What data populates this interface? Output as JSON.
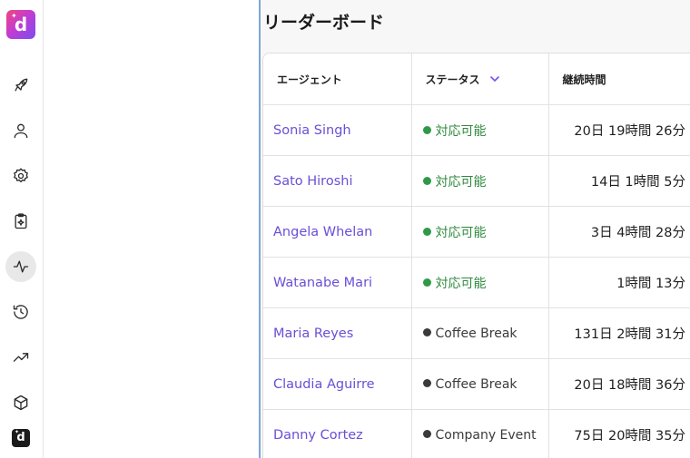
{
  "page": {
    "title": "リーダーボード"
  },
  "brand": {
    "logo_letter": "d"
  },
  "nav": [
    {
      "icon": "rocket-icon",
      "active": false
    },
    {
      "icon": "user-icon",
      "active": false
    },
    {
      "icon": "gear-icon",
      "active": false
    },
    {
      "icon": "clipboard-sparkle-icon",
      "active": false
    },
    {
      "icon": "activity-pulse-icon",
      "active": true
    },
    {
      "icon": "history-icon",
      "active": false
    },
    {
      "icon": "trending-up-icon",
      "active": false
    },
    {
      "icon": "cube-icon",
      "active": false
    }
  ],
  "table": {
    "headers": {
      "agent": "エージェント",
      "status": "ステータス",
      "duration": "継続時間"
    },
    "rows": [
      {
        "agent": "Sonia Singh",
        "status": "対応可能",
        "duration": "20日 19時間 26分"
      },
      {
        "agent": "Sato Hiroshi",
        "status": "対応可能",
        "duration": "14日 1時間 5分"
      },
      {
        "agent": "Angela Whelan",
        "status": "対応可能",
        "duration": "3日 4時間 28分"
      },
      {
        "agent": "Watanabe Mari",
        "status": "対応可能",
        "duration": "1時間 13分"
      },
      {
        "agent": "Maria Reyes",
        "status": "Coffee Break",
        "duration": "131日 2時間 31分"
      },
      {
        "agent": "Claudia Aguirre",
        "status": "Coffee Break",
        "duration": "20日 18時間 36分"
      },
      {
        "agent": "Danny Cortez",
        "status": "Company Event",
        "duration": "75日 20時間 35分"
      }
    ]
  },
  "colors": {
    "available": "#2e9a48",
    "other": "#3a3a3a",
    "link": "#6a4fd6",
    "accent": "#7a4df2"
  }
}
